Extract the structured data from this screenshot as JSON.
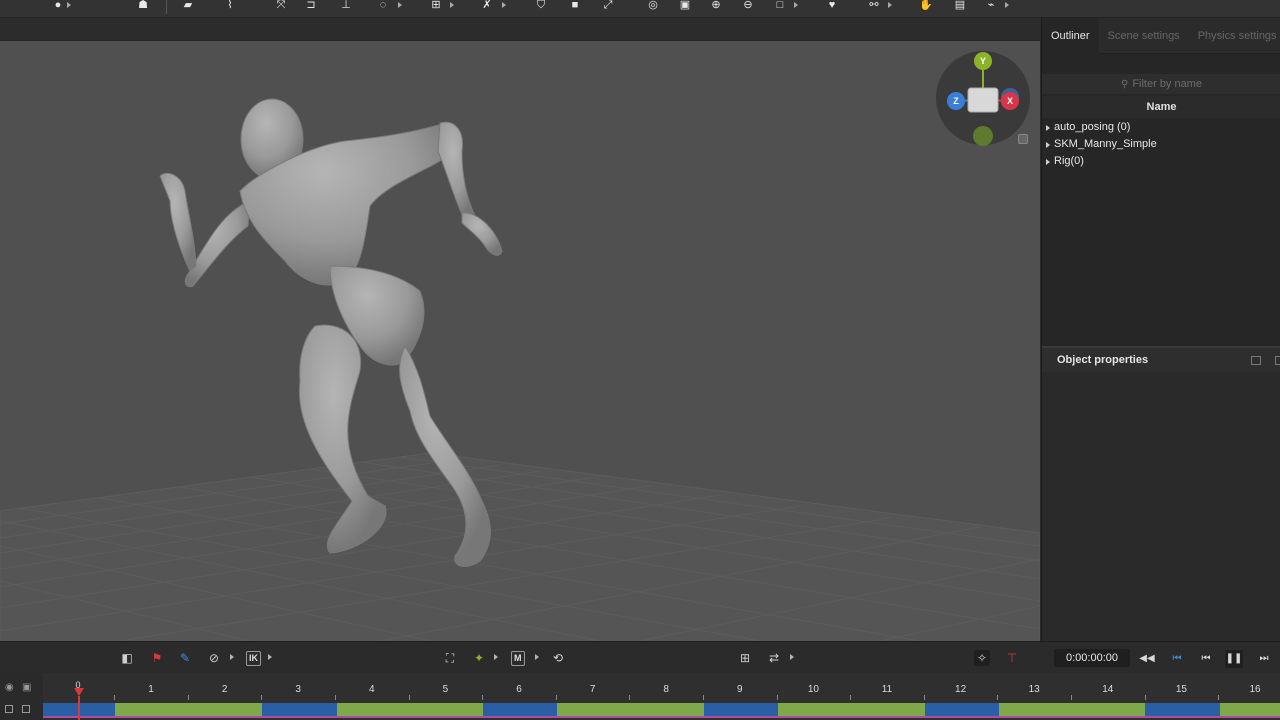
{
  "right_panel": {
    "tabs": [
      "Outliner",
      "Scene settings",
      "Physics settings"
    ],
    "filter_placeholder": "Filter by name",
    "column_header": "Name",
    "tree_items": [
      "auto_posing (0)",
      "SKM_Manny_Simple",
      "Rig(0)"
    ],
    "properties_title": "Object properties"
  },
  "gizmo": {
    "y_label": "Y",
    "x_label": "X",
    "z_label": "Z",
    "colors": {
      "y": "#8ab32a",
      "x": "#d9354a",
      "z": "#3a7fd6",
      "y_neg": "#5e7a2e"
    }
  },
  "controls": {
    "ik_label": "IK",
    "m_label": "M",
    "timecode": "0:00:00:00",
    "icons": [
      "split-icon",
      "flag-icon",
      "pin-icon",
      "disable-icon",
      "ik-icon",
      "frame-icon",
      "star-icon",
      "m-icon",
      "rotate-icon",
      "grid-icon",
      "bone-icon",
      "magic-icon",
      "marker-icon",
      "rewind-icon",
      "step-back-icon",
      "prev-frame-icon",
      "pause-icon",
      "next-frame-icon"
    ]
  },
  "timeline": {
    "playhead_label": "0",
    "frame_labels": [
      "1",
      "2",
      "3",
      "4",
      "5",
      "6",
      "7",
      "8",
      "9",
      "10",
      "11",
      "12",
      "13",
      "14",
      "15",
      "16"
    ],
    "segment_colors": {
      "blue": "#2a5fa6",
      "green": "#7fa84a",
      "playhead": "#d83a3a"
    },
    "segments": [
      "blue",
      "green",
      "blue",
      "green",
      "blue",
      "green",
      "blue",
      "green",
      "blue",
      "green",
      "blue",
      "green"
    ]
  }
}
